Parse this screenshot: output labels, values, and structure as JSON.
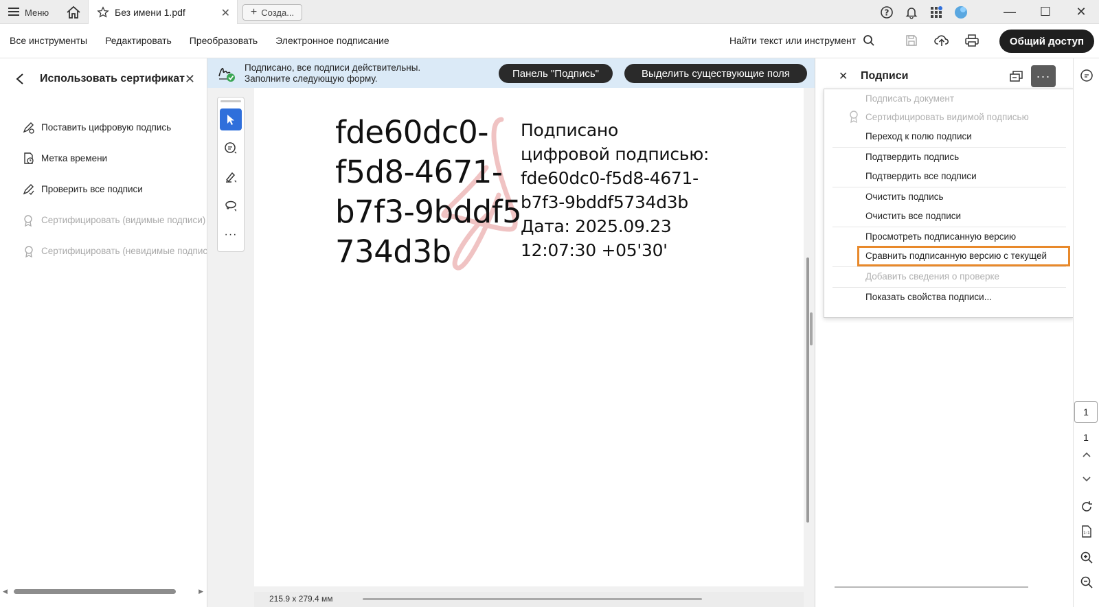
{
  "titlebar": {
    "menu_label": "Меню",
    "tab_title": "Без имени 1.pdf",
    "new_tab_label": "Созда..."
  },
  "toolbar": {
    "menu": [
      "Все инструменты",
      "Редактировать",
      "Преобразовать",
      "Электронное подписание"
    ],
    "search_label": "Найти текст или инструмент",
    "share_label": "Общий доступ"
  },
  "left_panel": {
    "title": "Использовать сертификат",
    "items": [
      {
        "label": "Поставить цифровую подпись",
        "icon": "signature-pen-icon",
        "disabled": false
      },
      {
        "label": "Метка времени",
        "icon": "timestamp-icon",
        "disabled": false
      },
      {
        "label": "Проверить все подписи",
        "icon": "verify-signature-icon",
        "disabled": false
      },
      {
        "label": "Сертифицировать (видимые подписи)",
        "icon": "certify-visible-icon",
        "disabled": true
      },
      {
        "label": "Сертифицировать (невидимые подписи)",
        "icon": "certify-invisible-icon",
        "disabled": true
      }
    ]
  },
  "banner": {
    "line1": "Подписано, все подписи действительны.",
    "line2": "Заполните следующую форму.",
    "panel_button": "Панель \"Подпись\"",
    "highlight_button": "Выделить существующие поля"
  },
  "document": {
    "signature_lines": [
      "fde60dc0-",
      "f5d8-4671-",
      "b7f3-9bddf5",
      "734d3b"
    ],
    "detail_lines": [
      "Подписано",
      "цифровой подписью:",
      "fde60dc0-f5d8-4671-",
      "b7f3-9bddf5734d3b",
      "Дата: 2025.09.23",
      "12:07:30 +05'30'"
    ],
    "page_size": "215.9 x 279.4 мм"
  },
  "right_panel": {
    "title": "Подписи",
    "dropdown": [
      {
        "label": "Подписать документ",
        "disabled": true
      },
      {
        "label": "Сертифицировать видимой подписью",
        "disabled": true
      },
      {
        "label": "Переход к полю подписи",
        "disabled": false
      },
      {
        "label": "Подтвердить подпись",
        "disabled": false
      },
      {
        "label": "Подтвердить все подписи",
        "disabled": false
      },
      {
        "label": "Очистить подпись",
        "disabled": false
      },
      {
        "label": "Очистить все подписи",
        "disabled": false
      },
      {
        "label": "Просмотреть подписанную версию",
        "disabled": false
      },
      {
        "label": "Сравнить подписанную версию с текущей",
        "disabled": false,
        "highlighted": true
      },
      {
        "label": "Добавить сведения о проверке",
        "disabled": true
      },
      {
        "label": "Показать свойства подписи...",
        "disabled": false
      }
    ]
  },
  "rail": {
    "current_page": "1",
    "total_pages": "1"
  },
  "colors": {
    "accent_blue": "#2f6fdb",
    "banner_bg": "#dbeaf7",
    "highlight_orange": "#e8892b",
    "dark_button": "#1f1f1f"
  }
}
